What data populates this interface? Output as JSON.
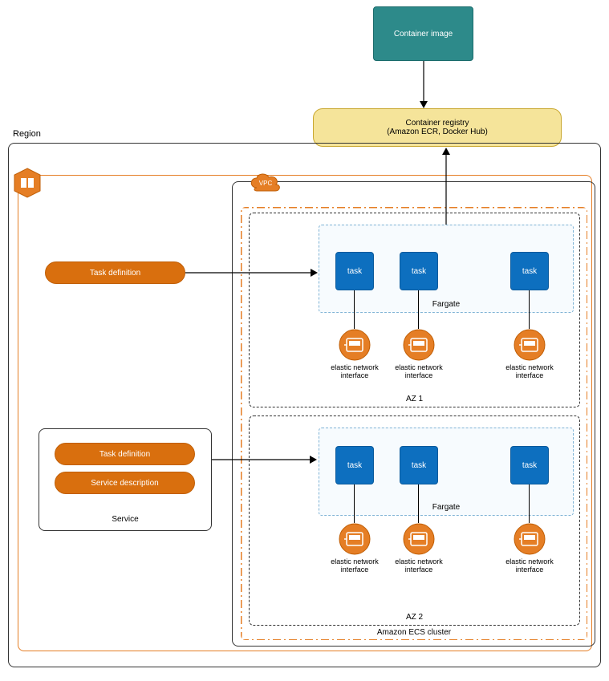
{
  "container_image_label": "Container image",
  "container_registry_title": "Container registry",
  "container_registry_subtitle": "(Amazon ECR, Docker Hub)",
  "region_label": "Region",
  "vpc_badge_label": "VPC",
  "cluster_label": "Amazon ECS cluster",
  "az1_label": "AZ 1",
  "az2_label": "AZ 2",
  "fargate_label": "Fargate",
  "task_label": "task",
  "eni_label": "elastic network interface",
  "task_definition_label": "Task definition",
  "service_description_label": "Service description",
  "service_label": "Service"
}
